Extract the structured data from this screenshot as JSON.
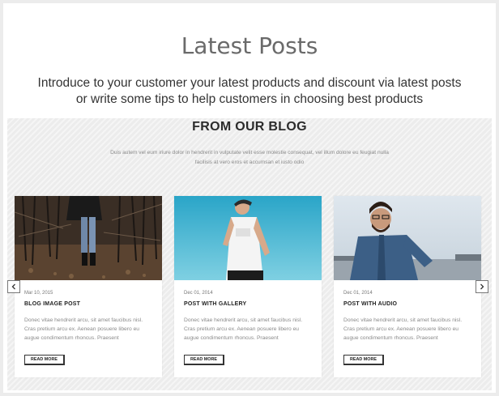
{
  "header": {
    "title": "Latest Posts",
    "intro_line1": "Introduce to your customer your latest products and discount via latest posts",
    "intro_line2": "or write some tips to help customers in choosing best products"
  },
  "blog": {
    "title": "FROM OUR BLOG",
    "desc_line1": "Duis autem vel eum iriure dolor in hendrerit in vulputate velit esse molestie consequat, vel illum dolore eu feugiat nulla",
    "desc_line2": "facilisis at vero eros et accumsan et iusto odio"
  },
  "posts": [
    {
      "date": "Mar 10, 2015",
      "title": "BLOG IMAGE POST",
      "excerpt": "Donec vitae hendrerit arcu, sit amet faucibus nisl. Cras pretium arcu ex. Aenean posuere libero eu augue condimentum rhoncus. Praesent",
      "read_more": "READ MORE"
    },
    {
      "date": "Dec 01, 2014",
      "title": "POST WITH GALLERY",
      "excerpt": "Donec vitae hendrerit arcu, sit amet faucibus nisl. Cras pretium arcu ex. Aenean posuere libero eu augue condimentum rhoncus. Praesent",
      "read_more": "READ MORE"
    },
    {
      "date": "Dec 01, 2014",
      "title": "POST WITH AUDIO",
      "excerpt": "Donec vitae hendrerit arcu, sit amet faucibus nisl. Cras pretium arcu ex. Aenean posuere libero eu augue condimentum rhoncus. Praesent",
      "read_more": "READ MORE"
    }
  ],
  "carousel": {
    "prev_icon": "chevron-left-icon",
    "next_icon": "chevron-right-icon"
  }
}
